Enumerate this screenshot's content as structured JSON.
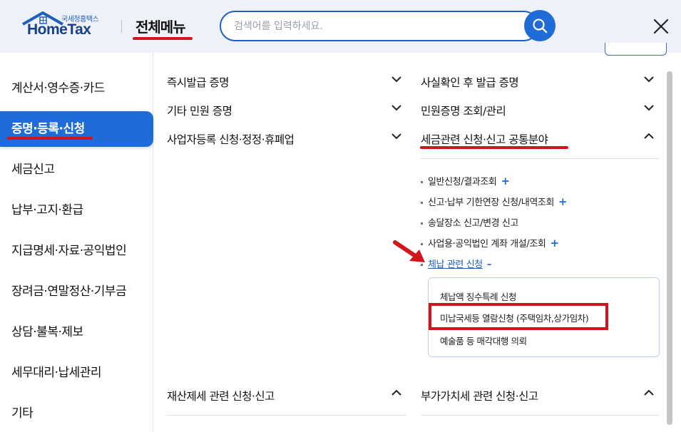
{
  "header": {
    "logo_sub": "국세청홈택스",
    "logo_main": "HomeTax",
    "menu_title": "전체메뉴",
    "search_placeholder": "검색어를 입력하세요."
  },
  "leftnav": {
    "items": [
      {
        "label": "계산서·영수증·카드"
      },
      {
        "label": "증명·등록·신청"
      },
      {
        "label": "세금신고"
      },
      {
        "label": "납부·고지·환급"
      },
      {
        "label": "지급명세·자료·공익법인"
      },
      {
        "label": "장려금·연말정산·기부금"
      },
      {
        "label": "상담·불복·제보"
      },
      {
        "label": "세무대리·납세관리"
      },
      {
        "label": "기타"
      }
    ],
    "active_index": 1
  },
  "content": {
    "left_col": {
      "items": [
        {
          "label": "즉시발급 증명",
          "expanded": false
        },
        {
          "label": "기타 민원 증명",
          "expanded": false
        },
        {
          "label": "사업자등록 신청·정정·휴폐업",
          "expanded": false
        },
        {
          "label": "재산제세 관련 신청·신고",
          "expanded": true
        }
      ]
    },
    "right_col": {
      "items": [
        {
          "label": "사실확인 후 발급 증명",
          "expanded": false
        },
        {
          "label": "민원증명 조회/관리",
          "expanded": false
        },
        {
          "label": "세금관련 신청·신고 공통분야",
          "expanded": true
        },
        {
          "label": "부가가치세 관련 신청·신고",
          "expanded": true
        }
      ],
      "sub_items": [
        {
          "label": "일반신청/결과조회",
          "toggle": "+"
        },
        {
          "label": "신고·납부 기한연장 신청/내역조회",
          "toggle": "+"
        },
        {
          "label": "송달장소 신고/변경 신고",
          "toggle": ""
        },
        {
          "label": "사업용·공익법인 계좌 개설/조회",
          "toggle": "+"
        },
        {
          "label": "체납 관련 신청",
          "toggle": "–"
        }
      ],
      "panel_items": [
        {
          "label": "체납액 징수특례 신청"
        },
        {
          "label": "미납국세등 열람신청 (주택임차,상가임차)"
        },
        {
          "label": "예술품 등 매각대행 의뢰"
        }
      ]
    }
  },
  "colors": {
    "accent": "#1f6bd8",
    "highlight_red": "#d0161b",
    "header_bg": "#eef2f8"
  }
}
